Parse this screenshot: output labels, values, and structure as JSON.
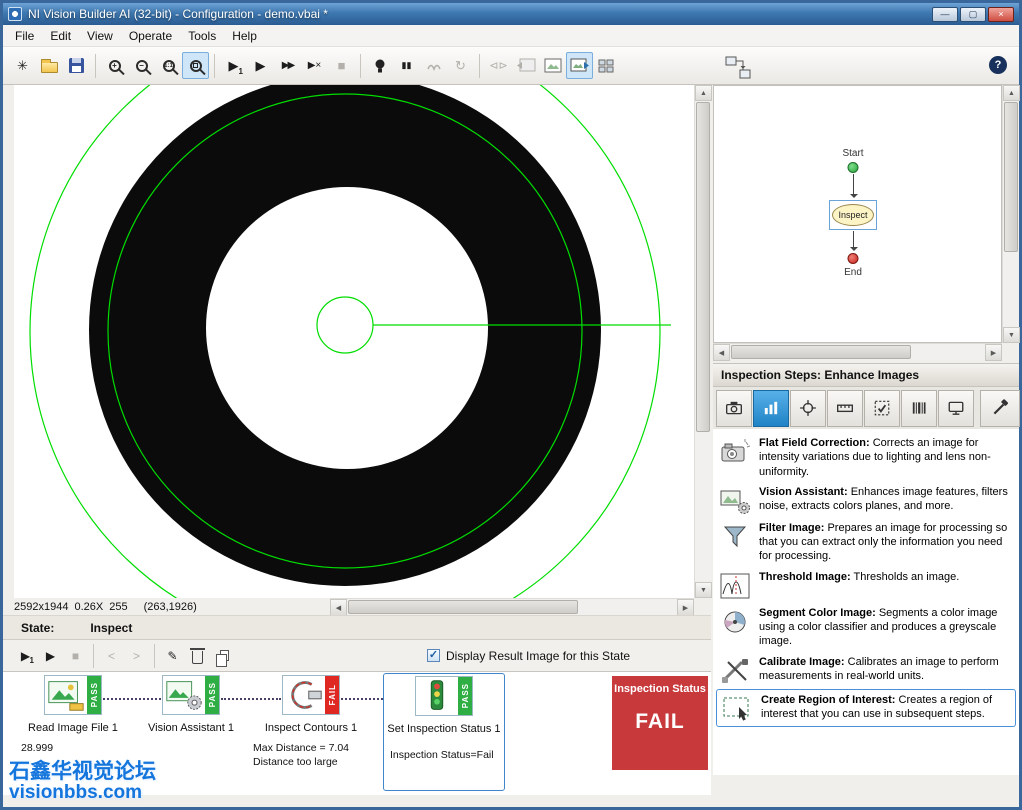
{
  "window": {
    "title": "NI Vision Builder AI (32-bit) - Configuration - demo.vbai *"
  },
  "glyphs": {
    "minimize": "—",
    "maximize": "▢",
    "close": "×",
    "new": "✳",
    "zoom_in": "+",
    "zoom_out": "−",
    "zoom_one_to_one": "1:1",
    "run_play": "▶",
    "run_once_badge": "1",
    "run_fast": "▶▶",
    "abort": "▶×",
    "stop": "■",
    "pause": "▮▮",
    "refresh": "↻",
    "compare": "⊲⊳",
    "nav_back": "<",
    "nav_forward": ">",
    "pencil": "✎",
    "help": "?",
    "check": "✓",
    "scroll_up": "▲",
    "scroll_down": "▼",
    "scroll_left": "◀",
    "scroll_right": "▶"
  },
  "menu": {
    "items": [
      "File",
      "Edit",
      "View",
      "Operate",
      "Tools",
      "Help"
    ]
  },
  "toolbar": {
    "icons": [
      "new-inspection-icon",
      "open-inspection-icon",
      "save-inspection-icon",
      "zoom-in-icon",
      "zoom-out-icon",
      "zoom-1-1-icon",
      "zoom-to-fit-icon",
      "run-inspection-once-icon",
      "run-inspection-icon",
      "run-inspection-loop-icon",
      "abort-inspection-icon",
      "stop-icon",
      "highlight-results-icon",
      "pause-icon",
      "pan-image-icon",
      "refresh-icon",
      "compare-images-icon",
      "previous-image-icon",
      "image-display-icon",
      "image-with-overlay-icon",
      "image-thumbnails-icon",
      "view-state-diagram-icon",
      "help-icon"
    ],
    "selected": [
      "zoom-to-fit",
      "image-with-overlay"
    ]
  },
  "image_view": {
    "resolution": "2592x1944",
    "zoom": "0.26X",
    "pixel_value": "255",
    "cursor_coords": "(263,1926)"
  },
  "state_diagram": {
    "start": "Start",
    "node": "Inspect",
    "end": "End"
  },
  "steps_panel": {
    "header": "Inspection Steps: Enhance Images",
    "palette_icons": [
      "acquire-images-icon",
      "enhance-images-icon",
      "locate-features-icon",
      "measure-features-icon",
      "check-for-presence-icon",
      "identify-parts-icon",
      "communicate-icon",
      "use-additional-tools-icon"
    ],
    "palette_selected": "enhance-images-icon",
    "steps": [
      {
        "name": "Flat Field Correction:",
        "description": "Corrects an image for intensity variations due to lighting and lens non-uniformity."
      },
      {
        "name": "Vision Assistant:",
        "description": "Enhances image features, filters noise, extracts colors planes, and more."
      },
      {
        "name": "Filter Image:",
        "description": "Prepares an image for processing so that you can extract only the information you need for processing."
      },
      {
        "name": "Threshold Image:",
        "description": "Thresholds an image."
      },
      {
        "name": "Segment Color Image:",
        "description": "Segments a color image using a color classifier and produces a greyscale image."
      },
      {
        "name": "Calibrate Image:",
        "description": "Calibrates an image to perform measurements in real-world units."
      },
      {
        "name": "Create Region of Interest:",
        "description": "Creates a region of interest that you can use in subsequent steps."
      }
    ]
  },
  "state_bar": {
    "label": "State:",
    "value": "Inspect"
  },
  "run_controls": {
    "display_checkbox_label": "Display Result Image for this State",
    "display_checkbox_checked": true
  },
  "sequence": {
    "steps": [
      {
        "name": "Read Image File 1",
        "status": "PASS",
        "details": [
          "28.999"
        ]
      },
      {
        "name": "Vision Assistant 1",
        "status": "PASS",
        "details": []
      },
      {
        "name": "Inspect Contours 1",
        "status": "FAIL",
        "details": [
          "Max Distance = 7.04",
          "Distance too large"
        ]
      },
      {
        "name": "Set Inspection Status 1",
        "status": "PASS",
        "details": [
          "Inspection Status=Fail"
        ],
        "selected": true
      }
    ]
  },
  "inspection_status": {
    "title": "Inspection Status",
    "value": "FAIL"
  },
  "watermark": {
    "line1": "石鑫华视觉论坛",
    "line2": "visionbbs.com"
  },
  "colors": {
    "pass_green": "#2fae43",
    "fail_red": "#e02823",
    "status_panel_red": "#c8393c",
    "selection_blue": "#4a90d8",
    "roi_overlay_green": "#00dd00",
    "watermark_blue": "#1475dd"
  }
}
